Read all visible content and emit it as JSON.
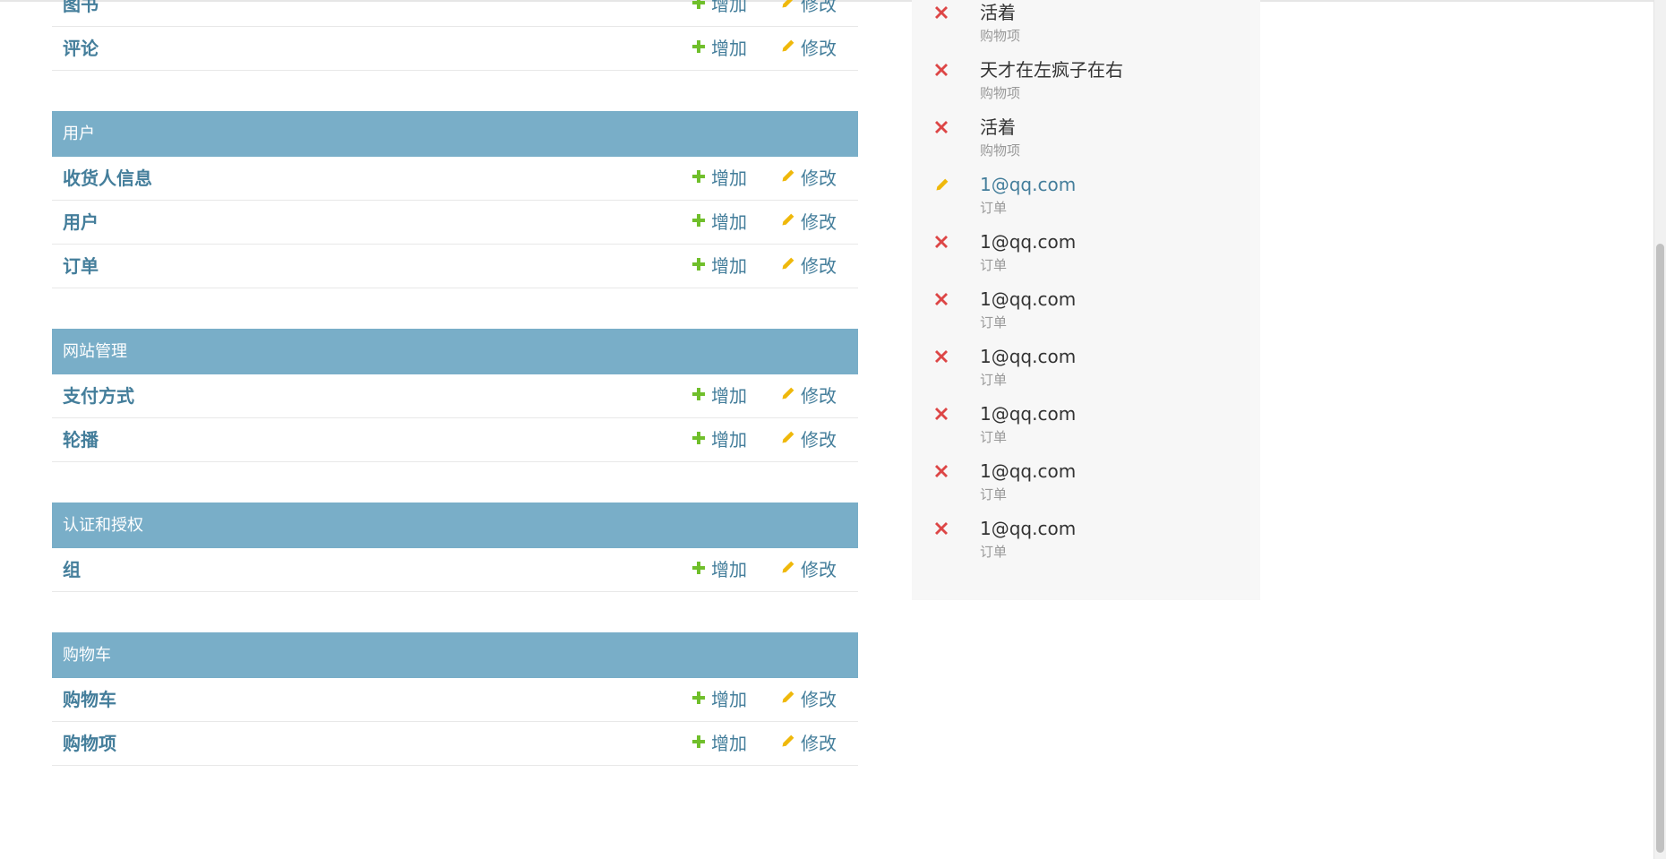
{
  "modules": [
    {
      "title": "",
      "rows": [
        {
          "label": "图书",
          "add": "增加",
          "change": "修改"
        },
        {
          "label": "评论",
          "add": "增加",
          "change": "修改"
        }
      ]
    },
    {
      "title": "用户",
      "rows": [
        {
          "label": "收货人信息",
          "add": "增加",
          "change": "修改"
        },
        {
          "label": "用户",
          "add": "增加",
          "change": "修改"
        },
        {
          "label": "订单",
          "add": "增加",
          "change": "修改"
        }
      ]
    },
    {
      "title": "网站管理",
      "rows": [
        {
          "label": "支付方式",
          "add": "增加",
          "change": "修改"
        },
        {
          "label": "轮播",
          "add": "增加",
          "change": "修改"
        }
      ]
    },
    {
      "title": "认证和授权",
      "rows": [
        {
          "label": "组",
          "add": "增加",
          "change": "修改"
        }
      ]
    },
    {
      "title": "购物车",
      "rows": [
        {
          "label": "购物车",
          "add": "增加",
          "change": "修改"
        },
        {
          "label": "购物项",
          "add": "增加",
          "change": "修改"
        }
      ]
    }
  ],
  "recent_actions": [
    {
      "action": "delete",
      "title": "活着",
      "type": "购物项"
    },
    {
      "action": "delete",
      "title": "天才在左疯子在右",
      "type": "购物项"
    },
    {
      "action": "delete",
      "title": "活着",
      "type": "购物项"
    },
    {
      "action": "change",
      "title": "1@qq.com",
      "type": "订单"
    },
    {
      "action": "delete",
      "title": "1@qq.com",
      "type": "订单"
    },
    {
      "action": "delete",
      "title": "1@qq.com",
      "type": "订单"
    },
    {
      "action": "delete",
      "title": "1@qq.com",
      "type": "订单"
    },
    {
      "action": "delete",
      "title": "1@qq.com",
      "type": "订单"
    },
    {
      "action": "delete",
      "title": "1@qq.com",
      "type": "订单"
    },
    {
      "action": "delete",
      "title": "1@qq.com",
      "type": "订单"
    }
  ],
  "icons": {
    "add": "plus-icon",
    "change": "pencil-icon",
    "delete": "x-icon"
  },
  "colors": {
    "module_header": "#79aec8",
    "link": "#447e9b",
    "add_icon": "#70bf2b",
    "change_icon": "#efb80b",
    "delete_icon": "#dd4646"
  }
}
